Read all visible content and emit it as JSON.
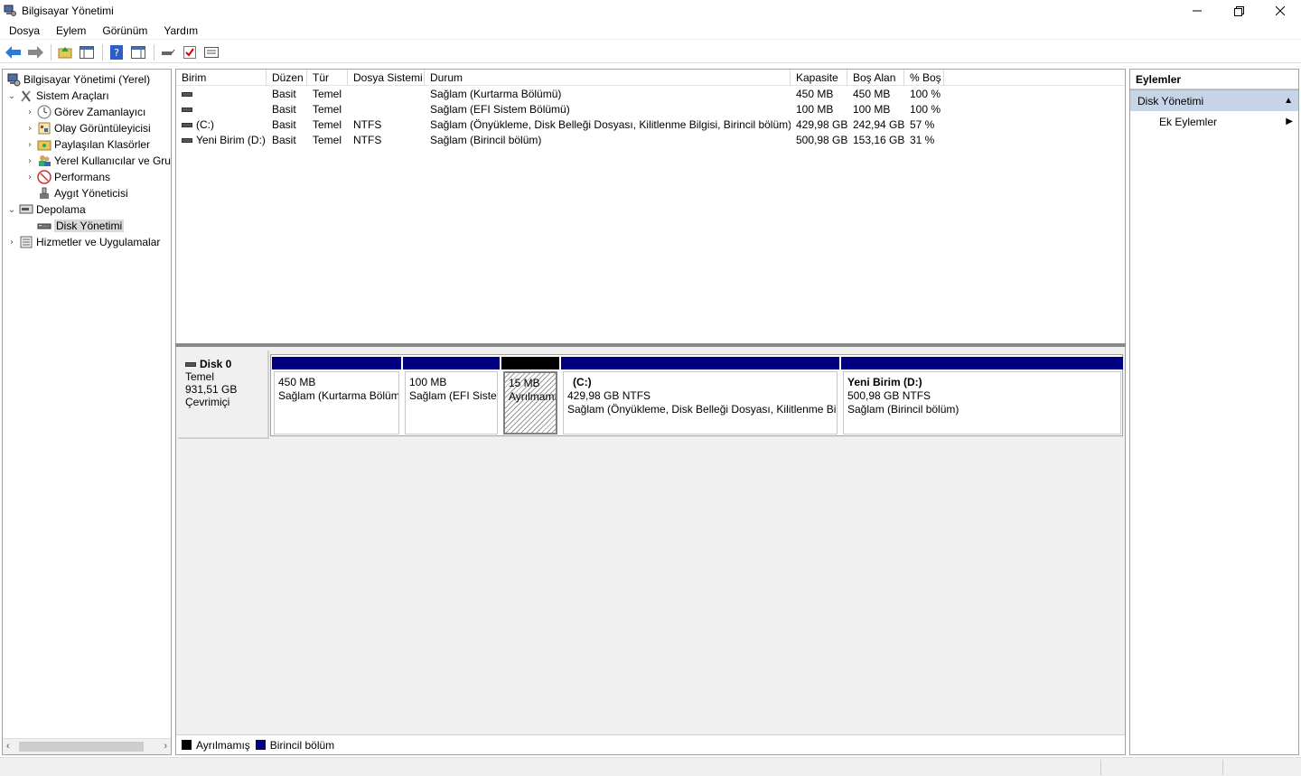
{
  "window": {
    "title": "Bilgisayar Yönetimi"
  },
  "menu": [
    "Dosya",
    "Eylem",
    "Görünüm",
    "Yardım"
  ],
  "tree": [
    {
      "label": "Bilgisayar Yönetimi (Yerel)",
      "level": 0,
      "chev": "",
      "icon": "computer-management-icon"
    },
    {
      "label": "Sistem Araçları",
      "level": 0,
      "chev": "v",
      "icon": "tools-icon"
    },
    {
      "label": "Görev Zamanlayıcı",
      "level": 1,
      "chev": ">",
      "icon": "clock-icon"
    },
    {
      "label": "Olay Görüntüleyicisi",
      "level": 1,
      "chev": ">",
      "icon": "event-viewer-icon"
    },
    {
      "label": "Paylaşılan Klasörler",
      "level": 1,
      "chev": ">",
      "icon": "shared-folder-icon"
    },
    {
      "label": "Yerel Kullanıcılar ve Gru",
      "level": 1,
      "chev": ">",
      "icon": "users-icon"
    },
    {
      "label": "Performans",
      "level": 1,
      "chev": ">",
      "icon": "performance-icon"
    },
    {
      "label": "Aygıt Yöneticisi",
      "level": 1,
      "chev": "",
      "icon": "device-manager-icon"
    },
    {
      "label": "Depolama",
      "level": 0,
      "chev": "v",
      "icon": "storage-icon"
    },
    {
      "label": "Disk Yönetimi",
      "level": 1,
      "chev": "",
      "icon": "disk-icon",
      "selected": true
    },
    {
      "label": "Hizmetler ve Uygulamalar",
      "level": 0,
      "chev": ">",
      "icon": "services-icon"
    }
  ],
  "volumes": {
    "columns": [
      "Birim",
      "Düzen",
      "Tür",
      "Dosya Sistemi",
      "Durum",
      "Kapasite",
      "Boş Alan",
      "% Boş"
    ],
    "rows": [
      [
        "",
        "Basit",
        "Temel",
        "",
        "Sağlam (Kurtarma Bölümü)",
        "450 MB",
        "450 MB",
        "100 %"
      ],
      [
        "",
        "Basit",
        "Temel",
        "",
        "Sağlam (EFI Sistem Bölümü)",
        "100 MB",
        "100 MB",
        "100 %"
      ],
      [
        "(C:)",
        "Basit",
        "Temel",
        "NTFS",
        "Sağlam (Önyükleme, Disk Belleği Dosyası, Kilitlenme Bilgisi, Birincil bölüm)",
        "429,98 GB",
        "242,94 GB",
        "57 %"
      ],
      [
        "Yeni Birim (D:)",
        "Basit",
        "Temel",
        "NTFS",
        "Sağlam (Birincil bölüm)",
        "500,98 GB",
        "153,16 GB",
        "31 %"
      ]
    ]
  },
  "disk": {
    "name": "Disk 0",
    "type": "Temel",
    "size": "931,51 GB",
    "status": "Çevrimiçi"
  },
  "partitions": [
    {
      "title": "",
      "size": "450 MB",
      "status": "Sağlam (Kurtarma Bölümü)",
      "kind": "primary"
    },
    {
      "title": "",
      "size": "100 MB",
      "status": "Sağlam (EFI Sistem Bölümü)",
      "kind": "primary"
    },
    {
      "title": "",
      "size": "15 MB",
      "status": "Ayrılmamış",
      "kind": "unallocated"
    },
    {
      "title": "(C:)",
      "size": "429,98 GB NTFS",
      "status": "Sağlam (Önyükleme, Disk Belleği Dosyası, Kilitlenme Bilgisi, Birincil bölüm)",
      "kind": "primary"
    },
    {
      "title": "Yeni Birim  (D:)",
      "size": "500,98 GB NTFS",
      "status": "Sağlam (Birincil bölüm)",
      "kind": "primary"
    }
  ],
  "legend": [
    {
      "label": "Ayrılmamış",
      "color": "#000000"
    },
    {
      "label": "Birincil bölüm",
      "color": "#000080"
    }
  ],
  "actions": {
    "header": "Eylemler",
    "section": "Disk Yönetimi",
    "item": "Ek Eylemler"
  },
  "colors": {
    "primary_bar": "#000080",
    "unalloc_bar": "#000000",
    "selected_action": "#c7d4e8"
  }
}
